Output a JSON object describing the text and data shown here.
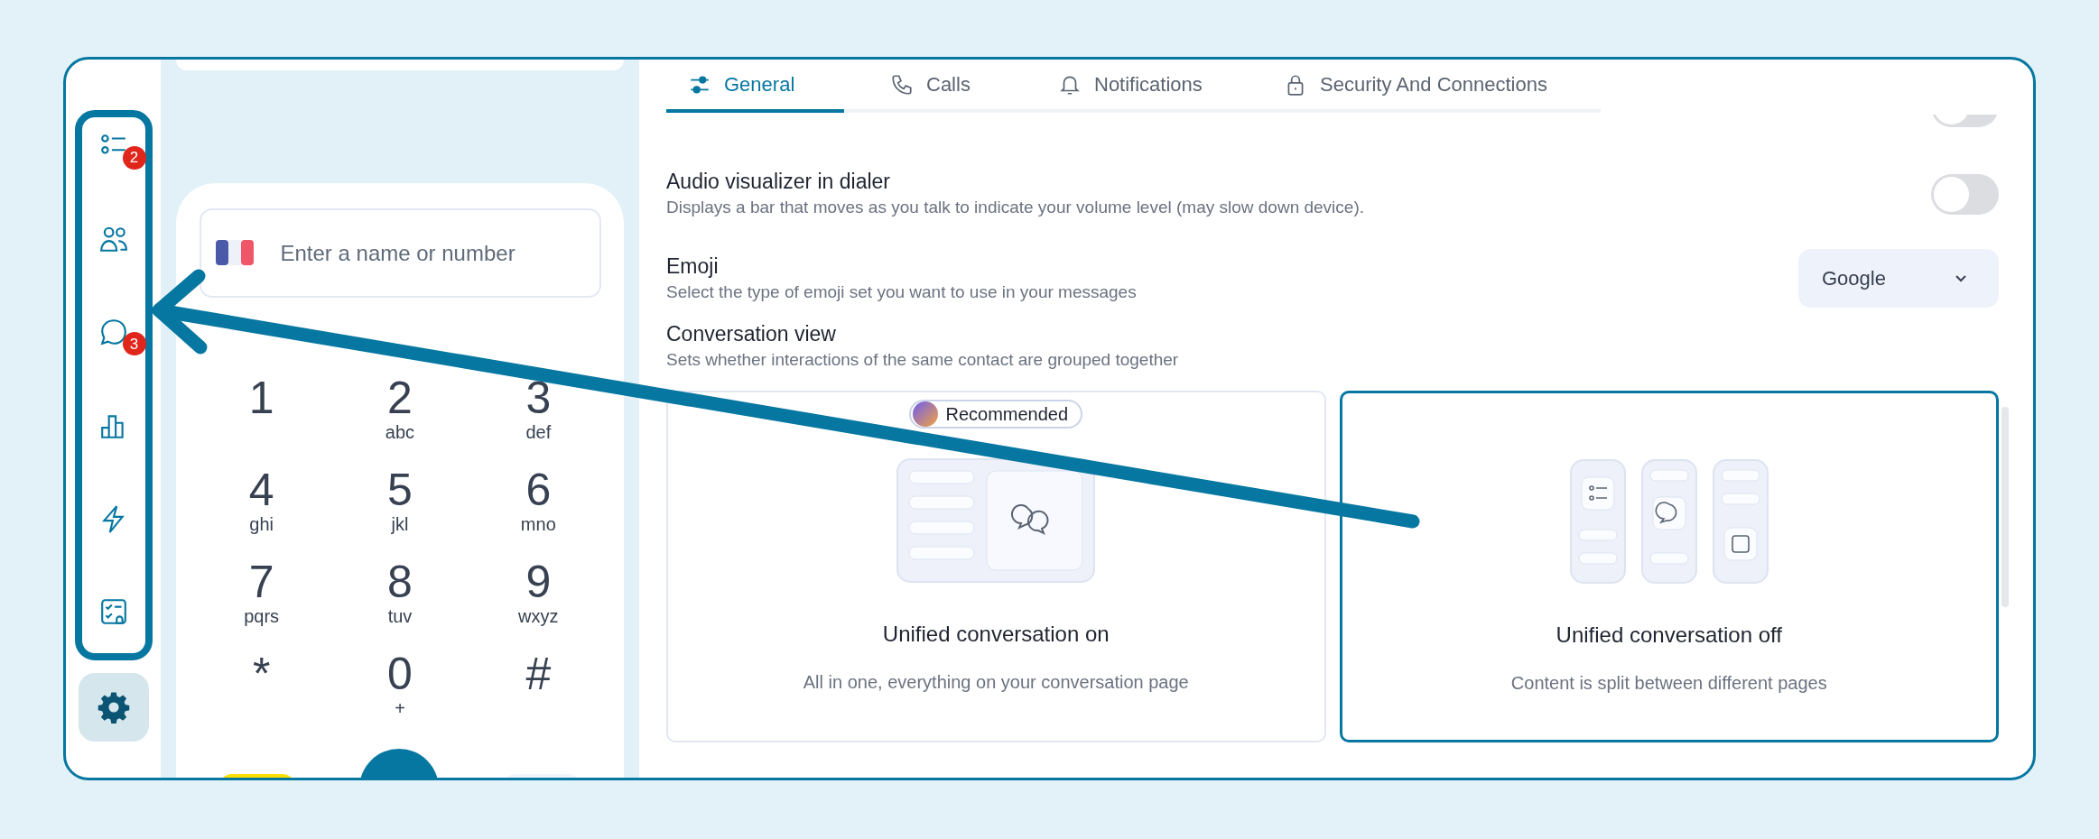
{
  "sidebar": {
    "items": [
      {
        "kind": "list",
        "badge": "2"
      },
      {
        "kind": "contacts"
      },
      {
        "kind": "chat",
        "badge": "3"
      },
      {
        "kind": "stats"
      },
      {
        "kind": "bolt"
      },
      {
        "kind": "tasks"
      }
    ],
    "settings_button": {
      "selected": true
    }
  },
  "dialer": {
    "search": {
      "placeholder": "Enter a name or number"
    },
    "keys": [
      {
        "digit": "1"
      },
      {
        "digit": "2",
        "letters": "abc"
      },
      {
        "digit": "3",
        "letters": "def"
      },
      {
        "digit": "4",
        "letters": "ghi"
      },
      {
        "digit": "5",
        "letters": "jkl"
      },
      {
        "digit": "6",
        "letters": "mno"
      },
      {
        "digit": "7",
        "letters": "pqrs"
      },
      {
        "digit": "8",
        "letters": "tuv"
      },
      {
        "digit": "9",
        "letters": "wxyz"
      },
      {
        "digit": "*"
      },
      {
        "digit": "0",
        "letters": "+"
      },
      {
        "digit": "#"
      }
    ]
  },
  "tabs": [
    {
      "kind": "sliders",
      "label": "General",
      "selected": true
    },
    {
      "kind": "phone",
      "label": "Calls",
      "selected": false
    },
    {
      "kind": "bell",
      "label": "Notifications",
      "selected": false
    },
    {
      "kind": "lock",
      "label": "Security And Connections",
      "selected": false
    }
  ],
  "settings": [
    {
      "kind": "clipped_toggle",
      "on": false
    },
    {
      "kind": "toggle",
      "title": "Audio visualizer in dialer",
      "description": "Displays a bar that moves as you talk to indicate your volume level (may slow down device).",
      "on": false
    },
    {
      "kind": "select",
      "title": "Emoji",
      "description": "Select the type of emoji set you want to use in your messages",
      "value": "Google"
    },
    {
      "kind": "choice",
      "title": "Conversation view",
      "description": "Sets whether interactions of the same contact are grouped together",
      "options": [
        {
          "kind": "unified",
          "badge": "Recommended",
          "title": "Unified conversation on",
          "description": "All in one, everything on your conversation page",
          "selected": false
        },
        {
          "kind": "split",
          "title": "Unified conversation off",
          "description": "Content is split between different pages",
          "selected": true
        }
      ]
    }
  ]
}
